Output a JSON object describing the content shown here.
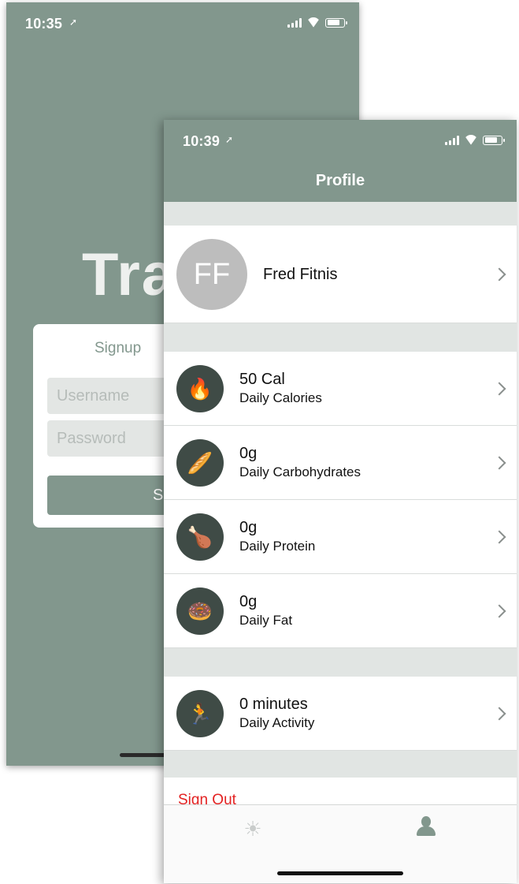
{
  "back_screen": {
    "status": {
      "time": "10:35",
      "location_icon": "location-arrow-icon"
    },
    "brand_text": "Tra",
    "signup": {
      "title": "Signup",
      "username_placeholder": "Username",
      "password_placeholder": "Password",
      "button_label": "S"
    }
  },
  "front_screen": {
    "status": {
      "time": "10:39",
      "location_icon": "location-arrow-icon"
    },
    "nav_title": "Profile",
    "user": {
      "initials": "FF",
      "name": "Fred Fitnis"
    },
    "stats": [
      {
        "icon": "🔥",
        "icon_name": "fire-icon",
        "value": "50 Cal",
        "label": "Daily Calories"
      },
      {
        "icon": "🥖",
        "icon_name": "bread-icon",
        "value": "0g",
        "label": "Daily Carbohydrates"
      },
      {
        "icon": "🍗",
        "icon_name": "poultry-leg-icon",
        "value": "0g",
        "label": "Daily Protein"
      },
      {
        "icon": "🍩",
        "icon_name": "doughnut-icon",
        "value": "0g",
        "label": "Daily Fat"
      }
    ],
    "activity": {
      "icon": "🏃",
      "icon_name": "runner-icon",
      "value": "0 minutes",
      "label": "Daily Activity"
    },
    "sign_out_label": "Sign Out",
    "tabs": [
      {
        "icon": "☀",
        "icon_name": "sun-icon"
      },
      {
        "icon_name": "person-icon"
      }
    ],
    "colors": {
      "accent": "#82978d",
      "separator": "#e1e5e3",
      "icon_circle": "#3f4b46",
      "sign_out": "#e32222"
    }
  }
}
